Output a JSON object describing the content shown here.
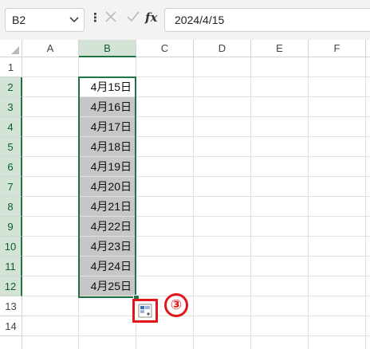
{
  "formula_bar": {
    "name_box": "B2",
    "formula_value": "2024/4/15",
    "fx_label": "fx",
    "more_label": "⋮"
  },
  "columns": [
    "A",
    "B",
    "C",
    "D",
    "E",
    "F"
  ],
  "selected_column": "B",
  "rows": [
    "1",
    "2",
    "3",
    "4",
    "5",
    "6",
    "7",
    "8",
    "9",
    "10",
    "11",
    "12",
    "13",
    "14"
  ],
  "selected_rows": [
    "2",
    "3",
    "4",
    "5",
    "6",
    "7",
    "8",
    "9",
    "10",
    "11",
    "12"
  ],
  "column_b_values": [
    "4月15日",
    "4月16日",
    "4月17日",
    "4月18日",
    "4月19日",
    "4月20日",
    "4月21日",
    "4月22日",
    "4月23日",
    "4月24日",
    "4月25日"
  ],
  "annotation": {
    "step_marker": "③",
    "color": "#e0161a"
  },
  "colors": {
    "selection": "#217346",
    "selected_fill": "#c6c6c6",
    "header_highlight": "#d3e3d6"
  },
  "icons": [
    "chevron-down-icon",
    "cancel-x-icon",
    "check-icon",
    "auto-fill-options-icon"
  ]
}
